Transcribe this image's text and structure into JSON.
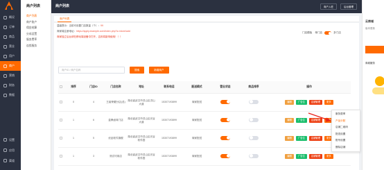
{
  "sidebar": {
    "items": [
      {
        "label": "概况",
        "icon": "home-icon"
      },
      {
        "label": "订单",
        "icon": "order-icon"
      },
      {
        "label": "商品",
        "icon": "goods-icon"
      },
      {
        "label": "营业",
        "icon": "store-icon"
      },
      {
        "label": "用户",
        "icon": "user-icon"
      },
      {
        "label": "商户",
        "icon": "merchant-icon",
        "active": true
      },
      {
        "label": "营销",
        "icon": "marketing-icon"
      },
      {
        "label": "财务",
        "icon": "finance-icon"
      },
      {
        "label": "数据",
        "icon": "data-icon"
      }
    ],
    "bottom_items": [
      {
        "label": "设置",
        "icon": "settings-icon"
      },
      {
        "label": "应用",
        "icon": "app-icon"
      },
      {
        "label": "渠道",
        "icon": "channel-icon"
      }
    ]
  },
  "subnav": {
    "title": "商户列表",
    "items": [
      "商户列表",
      "商户账户",
      "佣金结算",
      "分成设置",
      "服务费率",
      "连锁服务"
    ]
  },
  "topbar": {
    "title": "商户列表",
    "buttons": [
      "商户入驻",
      "后台管理"
    ]
  },
  "breadcrumb": {
    "tab": "商户列表"
  },
  "notice": {
    "line1_prefix": "温馨提示：当前可设置门店数量（个）：",
    "line1_value": "99",
    "line2_prefix": "商家端注册地址：",
    "line2_value": "https://apply.example.com/index.php?s=/store/add",
    "line3": "商家独立后台请在移动端设备中打开，否则将影响使用！！！",
    "switch_label": "门店模板",
    "switch_on": "单门店",
    "switch_off": "多门店"
  },
  "search": {
    "placeholder": "商户ID / 商户名称",
    "search_btn": "搜索",
    "add_btn": "新增商户"
  },
  "table": {
    "headers": [
      "",
      "排序",
      "门店ID",
      "门店名称",
      "地址",
      "联系电话",
      "配送模式",
      "营业状态",
      "商品排序",
      "操作"
    ],
    "rows": [
      {
        "sort": "0",
        "id": "4",
        "name": "王者荣耀分店(总)",
        "address": "湖北省武汉市洪山区洪山大道",
        "phone": "15307193899",
        "mode": "商家配送",
        "status": true,
        "goods_sort": false
      },
      {
        "sort": "1",
        "id": "6",
        "name": "金牌卤味门店",
        "address": "湖北省武汉市洪山区光谷大道",
        "phone": "15307193899",
        "mode": "商家配送",
        "status": true,
        "goods_sort": false
      },
      {
        "sort": "1",
        "id": "5",
        "name": "优品软件旗舰",
        "address": "湖北省武汉市洪山区光谷软件园",
        "phone": "15307193899",
        "mode": "商家配送",
        "status": true,
        "goods_sort": false
      },
      {
        "sort": "1",
        "id": "3",
        "name": "测试可用店",
        "address": "湖北省武汉市洪山区光谷软件园",
        "phone": "15307193899",
        "mode": "商家配送",
        "status": true,
        "goods_sort": false
      }
    ],
    "op_labels": {
      "edit": "编辑",
      "ad": "广告位",
      "manage": "店铺管理",
      "more": "更多"
    }
  },
  "dropdown": {
    "items": [
      "服务费率",
      "产品分配",
      "店铺二维码",
      "配送设置",
      "账号设置",
      "删除店铺"
    ],
    "active_index": 1
  },
  "right_panel": {
    "title": "云商城",
    "subtitle": "版本更新",
    "label": "商城服务"
  },
  "colors": {
    "accent": "#ff6a00",
    "sidebar_bg": "#2b3140",
    "success": "#19be6b",
    "danger": "#ed4014",
    "warning": "#f0a040"
  }
}
